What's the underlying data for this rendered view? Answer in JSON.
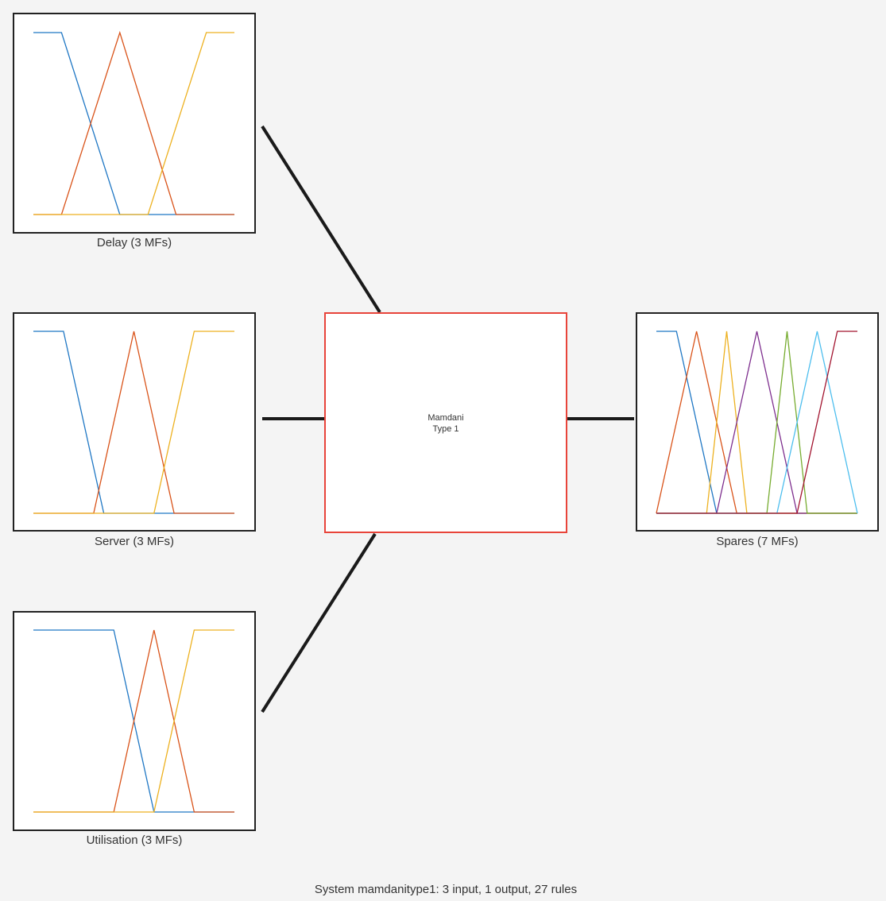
{
  "colors": {
    "background": "#f4f4f4",
    "box_border": "#222222",
    "system_border": "#e8443a",
    "connector": "#1a1a1a"
  },
  "inputs": [
    {
      "label": "Delay (3 MFs)",
      "mfs": [
        {
          "color": "#1f77c4",
          "points": [
            [
              0,
              1
            ],
            [
              0.14,
              1
            ],
            [
              0.43,
              0
            ],
            [
              1,
              0
            ]
          ]
        },
        {
          "color": "#d95319",
          "points": [
            [
              0,
              0
            ],
            [
              0.14,
              0
            ],
            [
              0.43,
              1
            ],
            [
              0.71,
              0
            ],
            [
              1,
              0
            ]
          ]
        },
        {
          "color": "#edb120",
          "points": [
            [
              0,
              0
            ],
            [
              0.57,
              0
            ],
            [
              0.86,
              1
            ],
            [
              1,
              1
            ]
          ]
        }
      ]
    },
    {
      "label": "Server (3 MFs)",
      "mfs": [
        {
          "color": "#1f77c4",
          "points": [
            [
              0,
              1
            ],
            [
              0.15,
              1
            ],
            [
              0.35,
              0
            ],
            [
              1,
              0
            ]
          ]
        },
        {
          "color": "#d95319",
          "points": [
            [
              0,
              0
            ],
            [
              0.3,
              0
            ],
            [
              0.5,
              1
            ],
            [
              0.7,
              0
            ],
            [
              1,
              0
            ]
          ]
        },
        {
          "color": "#edb120",
          "points": [
            [
              0,
              0
            ],
            [
              0.6,
              0
            ],
            [
              0.8,
              1
            ],
            [
              1,
              1
            ]
          ]
        }
      ]
    },
    {
      "label": "Utilisation (3 MFs)",
      "mfs": [
        {
          "color": "#1f77c4",
          "points": [
            [
              0,
              1
            ],
            [
              0.4,
              1
            ],
            [
              0.6,
              0
            ],
            [
              1,
              0
            ]
          ]
        },
        {
          "color": "#d95319",
          "points": [
            [
              0,
              0
            ],
            [
              0.4,
              0
            ],
            [
              0.6,
              1
            ],
            [
              0.8,
              0
            ],
            [
              1,
              0
            ]
          ]
        },
        {
          "color": "#edb120",
          "points": [
            [
              0,
              0
            ],
            [
              0.6,
              0
            ],
            [
              0.8,
              1
            ],
            [
              1,
              1
            ]
          ]
        }
      ]
    }
  ],
  "system": {
    "line1": "Mamdani",
    "line2": "Type 1"
  },
  "output": {
    "label": "Spares (7 MFs)",
    "mfs": [
      {
        "color": "#1f77c4",
        "points": [
          [
            0,
            1
          ],
          [
            0.1,
            1
          ],
          [
            0.3,
            0
          ],
          [
            1,
            0
          ]
        ]
      },
      {
        "color": "#d95319",
        "points": [
          [
            0,
            0
          ],
          [
            0.2,
            1
          ],
          [
            0.4,
            0
          ],
          [
            1,
            0
          ]
        ]
      },
      {
        "color": "#edb120",
        "points": [
          [
            0,
            0
          ],
          [
            0.25,
            0
          ],
          [
            0.35,
            1
          ],
          [
            0.45,
            0
          ],
          [
            1,
            0
          ]
        ]
      },
      {
        "color": "#7e2f8e",
        "points": [
          [
            0,
            0
          ],
          [
            0.3,
            0
          ],
          [
            0.5,
            1
          ],
          [
            0.7,
            0
          ],
          [
            1,
            0
          ]
        ]
      },
      {
        "color": "#77ac30",
        "points": [
          [
            0,
            0
          ],
          [
            0.55,
            0
          ],
          [
            0.65,
            1
          ],
          [
            0.75,
            0
          ],
          [
            1,
            0
          ]
        ]
      },
      {
        "color": "#4dbeee",
        "points": [
          [
            0,
            0
          ],
          [
            0.6,
            0
          ],
          [
            0.8,
            1
          ],
          [
            1,
            0
          ]
        ]
      },
      {
        "color": "#a2142f",
        "points": [
          [
            0,
            0
          ],
          [
            0.7,
            0
          ],
          [
            0.9,
            1
          ],
          [
            1,
            1
          ]
        ]
      }
    ]
  },
  "caption": "System mamdanitype1: 3 input, 1 output, 27 rules"
}
